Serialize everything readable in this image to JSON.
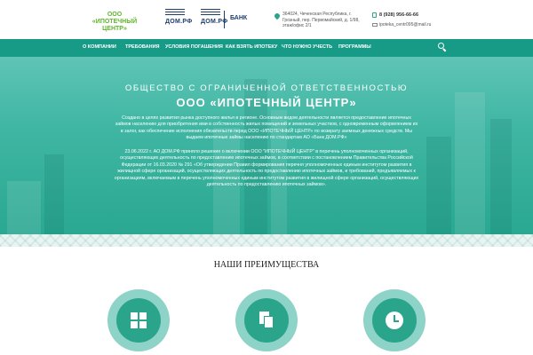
{
  "header": {
    "logo_text": "ООО «ИПОТЕЧНЫЙ ЦЕНТР»",
    "partner_logo_1": "ДОМ.РФ",
    "partner_logo_2": "ДОМ.РФ",
    "partner_bank": "БАНК",
    "address": "364024, Чеченская Республика, г. Грозный, пер. Первомайский, д. 1/98, этаж/офис 2/1",
    "phone": "8 (928) 956-66-66",
    "email": "ipoteka_centr095@mail.ru",
    "icons": {
      "address": "map-pin-icon",
      "phone": "phone-icon",
      "email": "mail-icon"
    }
  },
  "nav": {
    "items": [
      "О КОМПАНИИ",
      "ТРЕБОВАНИЯ",
      "УСЛОВИЯ ПОГАШЕНИЯ",
      "КАК ВЗЯТЬ ИПОТЕКУ",
      "ЧТО НУЖНО УЧЕСТЬ",
      "ПРОГРАММЫ"
    ],
    "search_icon": "search-icon"
  },
  "hero": {
    "subtitle": "ОБЩЕСТВО С ОГРАНИЧЕННОЙ ОТВЕТСТВЕННОСТЬЮ",
    "title": "ООО «ИПОТЕЧНЫЙ ЦЕНТР»",
    "paragraph_1": "Создано в целях развития рынка доступного жилья в регионе. Основным видом деятельности является предоставление ипотечных займов населению для приобретения ими в собственность жилых помещений и земельных участков, с одновременным оформлением их в залог, как обеспечение исполнения обязательств перед ООО «ИПОТЕЧНЫЙ ЦЕНТР» по возврату заемных денежных средств. Мы выдаем ипотечные займы населению по стандартам АО «Банк ДОМ.РФ»",
    "paragraph_2": "23.06.2022 г. АО ДОМ.РФ приняло решение о включении ООО \"ИПОТЕЧНЫЙ ЦЕНТР\" в перечень уполномоченных организаций, осуществляющих деятельность по предоставлению ипотечных займов, в соответствии с постановлением Правительства Российской Федерации от 16.03.2020 № 291 «Об утверждении Правил формирования перечня уполномоченных единым институтом развития в жилищной сфере организаций, осуществляющих деятельность по предоставлению ипотечных займов, и требований, предъявляемых к организациям, включаемым в перечень уполномоченных единым институтом развития в жилищной сфере организаций, осуществляющих деятельность по предоставлению ипотечных займов»."
  },
  "advantages": {
    "title": "НАШИ ПРЕИМУЩЕСТВА",
    "icons": [
      "grid-icon",
      "documents-icon",
      "clock-icon"
    ]
  },
  "colors": {
    "accent": "#179b86",
    "hero_top": "#5fc4b6",
    "hero_bottom": "#2aa891",
    "logo_green": "#5fb52a",
    "brand_navy": "#1f3e6f",
    "circle_outer": "#8dd3c8",
    "circle_inner": "#2aa58c"
  }
}
